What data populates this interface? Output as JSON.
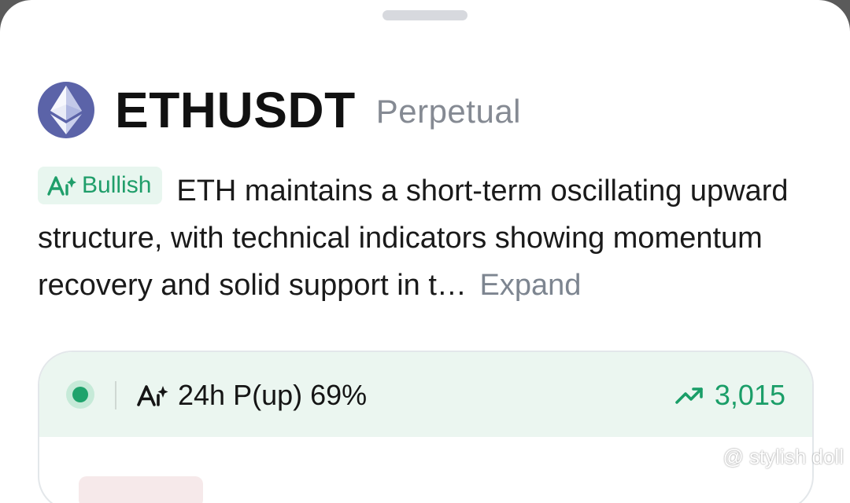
{
  "header": {
    "symbol": "ETHUSDT",
    "contract_type": "Perpetual",
    "coin_icon": "ethereum-logo-icon"
  },
  "summary": {
    "sentiment_label": "Bullish",
    "sentiment_icon": "ai-sparkle-icon",
    "text": "ETH maintains a short-term oscillating upward structure, with technical indicators showing momentum recovery and solid support in t…",
    "expand_label": "Expand"
  },
  "prediction_card": {
    "status_icon": "live-dot-icon",
    "prob_icon": "ai-sparkle-icon",
    "probability_label": "24h P(up) 69%",
    "trend_icon": "trending-up-icon",
    "price": "3,015"
  },
  "watermark": {
    "text": "@ stylish doll"
  },
  "colors": {
    "accent_green": "#1f9e6a",
    "badge_bg": "#e8f6ef",
    "card_head_bg": "#ebf6f0",
    "muted_text": "#858a93"
  }
}
